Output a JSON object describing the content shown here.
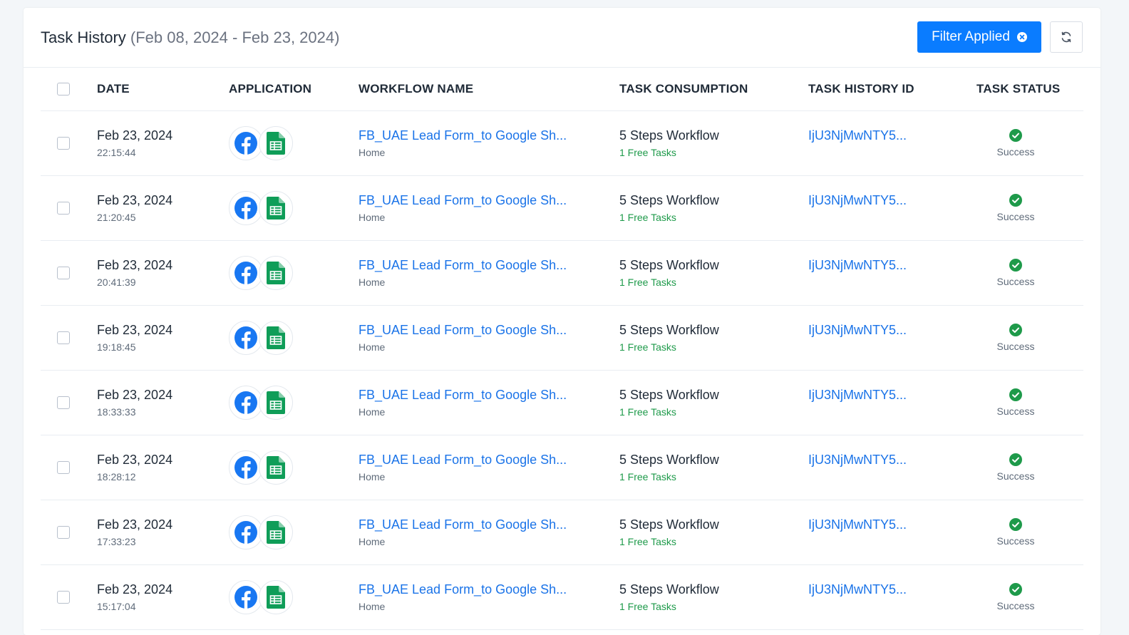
{
  "header": {
    "title": "Task History",
    "range": "(Feb 08, 2024 - Feb 23, 2024)",
    "filter_label": "Filter Applied"
  },
  "columns": {
    "date": "DATE",
    "application": "APPLICATION",
    "workflow": "WORKFLOW NAME",
    "consumption": "TASK CONSUMPTION",
    "history_id": "TASK HISTORY ID",
    "status": "TASK STATUS"
  },
  "colors": {
    "accent": "#0a7cff",
    "link": "#1a73e8",
    "success": "#1e9a4a",
    "facebook": "#1877f2",
    "sheets": "#0f9d58"
  },
  "icons": {
    "apps": [
      "facebook-icon",
      "google-sheets-icon"
    ],
    "status": "check-circle-icon",
    "refresh": "refresh-icon",
    "clear_filter": "close-circle-icon"
  },
  "rows": [
    {
      "date": "Feb 23, 2024",
      "time": "22:15:44",
      "workflow": "FB_UAE Lead Form_to Google Sh...",
      "folder": "Home",
      "consumption": "5 Steps Workflow",
      "free": "1 Free Tasks",
      "history_id": "IjU3NjMwNTY5...",
      "status": "Success"
    },
    {
      "date": "Feb 23, 2024",
      "time": "21:20:45",
      "workflow": "FB_UAE Lead Form_to Google Sh...",
      "folder": "Home",
      "consumption": "5 Steps Workflow",
      "free": "1 Free Tasks",
      "history_id": "IjU3NjMwNTY5...",
      "status": "Success"
    },
    {
      "date": "Feb 23, 2024",
      "time": "20:41:39",
      "workflow": "FB_UAE Lead Form_to Google Sh...",
      "folder": "Home",
      "consumption": "5 Steps Workflow",
      "free": "1 Free Tasks",
      "history_id": "IjU3NjMwNTY5...",
      "status": "Success"
    },
    {
      "date": "Feb 23, 2024",
      "time": "19:18:45",
      "workflow": "FB_UAE Lead Form_to Google Sh...",
      "folder": "Home",
      "consumption": "5 Steps Workflow",
      "free": "1 Free Tasks",
      "history_id": "IjU3NjMwNTY5...",
      "status": "Success"
    },
    {
      "date": "Feb 23, 2024",
      "time": "18:33:33",
      "workflow": "FB_UAE Lead Form_to Google Sh...",
      "folder": "Home",
      "consumption": "5 Steps Workflow",
      "free": "1 Free Tasks",
      "history_id": "IjU3NjMwNTY5...",
      "status": "Success"
    },
    {
      "date": "Feb 23, 2024",
      "time": "18:28:12",
      "workflow": "FB_UAE Lead Form_to Google Sh...",
      "folder": "Home",
      "consumption": "5 Steps Workflow",
      "free": "1 Free Tasks",
      "history_id": "IjU3NjMwNTY5...",
      "status": "Success"
    },
    {
      "date": "Feb 23, 2024",
      "time": "17:33:23",
      "workflow": "FB_UAE Lead Form_to Google Sh...",
      "folder": "Home",
      "consumption": "5 Steps Workflow",
      "free": "1 Free Tasks",
      "history_id": "IjU3NjMwNTY5...",
      "status": "Success"
    },
    {
      "date": "Feb 23, 2024",
      "time": "15:17:04",
      "workflow": "FB_UAE Lead Form_to Google Sh...",
      "folder": "Home",
      "consumption": "5 Steps Workflow",
      "free": "1 Free Tasks",
      "history_id": "IjU3NjMwNTY5...",
      "status": "Success"
    }
  ]
}
